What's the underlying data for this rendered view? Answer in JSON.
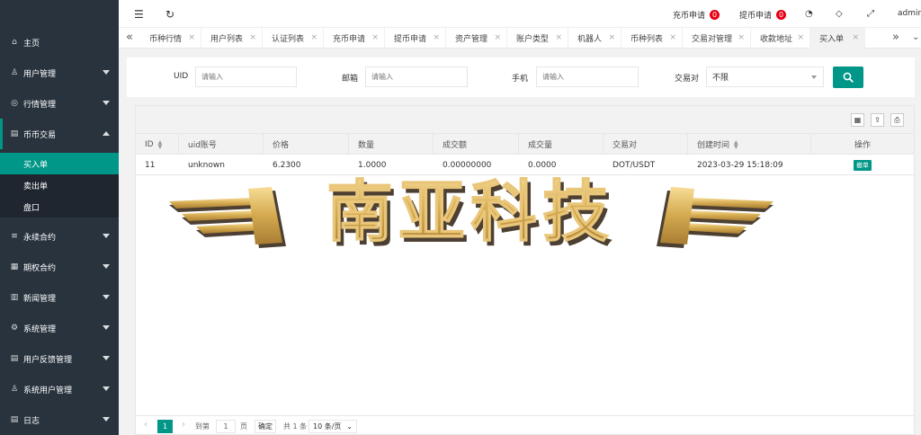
{
  "sidebar": {
    "items": [
      {
        "label": "主页",
        "icon": "home-icon"
      },
      {
        "label": "用户管理",
        "icon": "user-icon"
      },
      {
        "label": "行情管理",
        "icon": "market-icon"
      },
      {
        "label": "币币交易",
        "icon": "trade-icon"
      },
      {
        "label": "永续合约",
        "icon": "contract-icon"
      },
      {
        "label": "期权合约",
        "icon": "option-icon"
      },
      {
        "label": "新闻管理",
        "icon": "news-icon"
      },
      {
        "label": "系统管理",
        "icon": "gear-icon"
      },
      {
        "label": "用户反馈管理",
        "icon": "feedback-icon"
      },
      {
        "label": "系统用户管理",
        "icon": "admin-user-icon"
      },
      {
        "label": "日志",
        "icon": "log-icon"
      }
    ],
    "sub_items": [
      "买入单",
      "卖出单",
      "盘口"
    ]
  },
  "topbar": {
    "recharge_label": "充币申请",
    "recharge_count": "0",
    "withdraw_label": "提币申请",
    "withdraw_count": "0",
    "user": "admin"
  },
  "tabs": [
    {
      "label": "币种行情"
    },
    {
      "label": "用户列表"
    },
    {
      "label": "认证列表"
    },
    {
      "label": "充币申请"
    },
    {
      "label": "提币申请"
    },
    {
      "label": "资产管理"
    },
    {
      "label": "账户类型"
    },
    {
      "label": "机器人"
    },
    {
      "label": "币种列表"
    },
    {
      "label": "交易对管理"
    },
    {
      "label": "收款地址"
    },
    {
      "label": "买入单"
    }
  ],
  "search": {
    "uid_label": "UID",
    "uid_placeholder": "请输入",
    "email_label": "邮箱",
    "email_placeholder": "请输入",
    "phone_label": "手机",
    "phone_placeholder": "请输入",
    "pair_label": "交易对",
    "pair_value": "不限"
  },
  "table": {
    "columns": [
      "ID",
      "uid账号",
      "价格",
      "数量",
      "成交额",
      "成交量",
      "交易对",
      "创建时间",
      "操作"
    ],
    "rows": [
      {
        "id": "11",
        "uid": "unknown",
        "price": "6.2300",
        "amount": "1.0000",
        "turnover": "0.00000000",
        "volume": "0.0000",
        "pair": "DOT/USDT",
        "created": "2023-03-29 15:18:09",
        "action": "撤单"
      }
    ]
  },
  "pager": {
    "current": "1",
    "goto_label": "到第",
    "goto_value": "1",
    "page_unit": "页",
    "confirm": "确定",
    "total": "共 1 条",
    "page_size": "10 条/页"
  },
  "watermark": {
    "text": "南亚科技",
    "colors": {
      "gold": "#d9b25a",
      "shadow": "#5a4b3a",
      "highlight": "#f2d88f"
    }
  },
  "colors": {
    "accent": "#009688",
    "sidebar": "#28333e",
    "badge": "#e60012"
  }
}
